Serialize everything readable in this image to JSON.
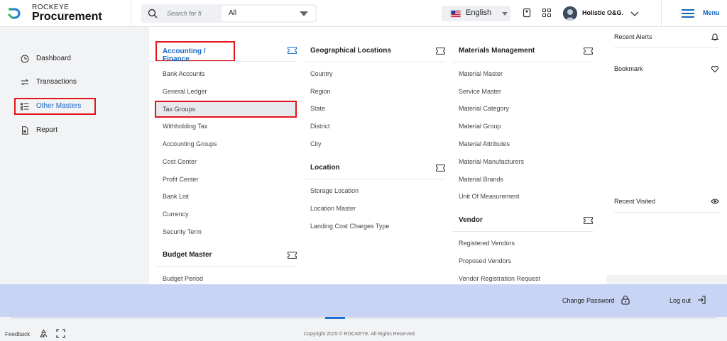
{
  "header": {
    "brand_top": "ROCKEYE",
    "brand_main": "Procurement",
    "search_placeholder": "Search for fi",
    "search_scope": "All",
    "language": "English",
    "user_name": "Holistic O&G.",
    "menu_label": "Menu"
  },
  "sidebar": {
    "items": [
      {
        "label": "Dashboard",
        "icon": "clock-pie-icon"
      },
      {
        "label": "Transactions",
        "icon": "swap-arrows-icon"
      },
      {
        "label": "Other Masters",
        "icon": "list-icon",
        "active": true
      },
      {
        "label": "Report",
        "icon": "document-icon"
      }
    ]
  },
  "mega_menu": {
    "accounting": {
      "title": "Accounting / Finance",
      "items": [
        "Bank Accounts",
        "General Ledger",
        "Tax Groups",
        "Withholding Tax",
        "Accounting Groups",
        "Cost Center",
        "Profit Center",
        "Bank List",
        "Currency",
        "Security Term"
      ]
    },
    "budget": {
      "title": "Budget Master",
      "items": [
        "Budget Period"
      ]
    },
    "geo": {
      "title": "Geographical Locations",
      "items": [
        "Country",
        "Region",
        "State",
        "District",
        "City"
      ]
    },
    "location": {
      "title": "Location",
      "items": [
        "Storage Location",
        "Location Master",
        "Landing Cost Charges Type"
      ]
    },
    "materials": {
      "title": "Materials Management",
      "items": [
        "Material Master",
        "Service Master",
        "Material Category",
        "Material Group",
        "Material Attributes",
        "Material Manufacturers",
        "Material Brands",
        "Unit Of Measurement"
      ]
    },
    "vendor": {
      "title": "Vendor",
      "items": [
        "Registered Vendors",
        "Proposed Vendors",
        "Vendor Registration Request"
      ]
    }
  },
  "right_panel": {
    "recent_alerts": "Recent Alerts",
    "bookmark": "Bookmark",
    "recent_visited": "Recent Visited"
  },
  "bottom_bar": {
    "change_password": "Change Password",
    "log_out": "Log out"
  },
  "footer": {
    "feedback": "Feedback",
    "copyright": "Copyright 2025 © ROCKEYE. All Rights Reserved"
  },
  "colors": {
    "accent": "#1565c0",
    "highlight": "#e3151a",
    "bottom_bar": "#c7d4f4"
  }
}
